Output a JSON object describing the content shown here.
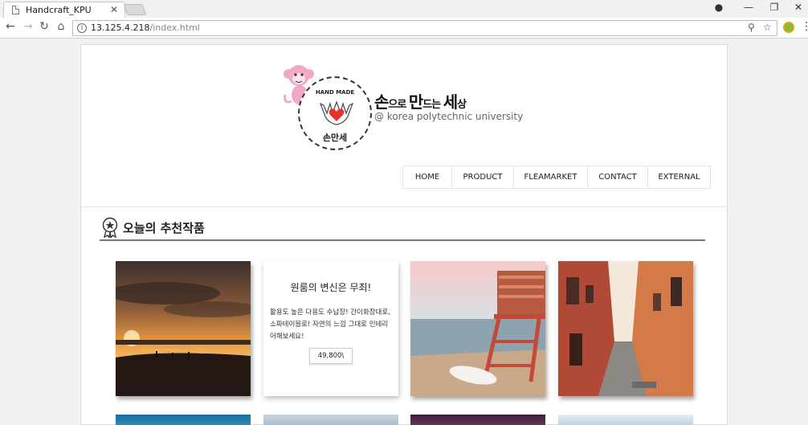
{
  "browser": {
    "tab_title": "Handcraft_KPU",
    "tab_close": "✕",
    "url_host": "13.125.4.218",
    "url_path": "/index.html",
    "info_glyph": "i",
    "back_glyph": "←",
    "forward_glyph": "→",
    "reload_glyph": "↻",
    "home_glyph": "⌂",
    "zoom_glyph": "⚲",
    "star_glyph": "☆",
    "menu_glyph": "⋮",
    "account_glyph": "●",
    "minimize_glyph": "—",
    "restore_glyph": "❐",
    "close_glyph": "✕"
  },
  "site": {
    "seal_top": "HAND MADE",
    "seal_bottom": "손만세",
    "title_big": "손",
    "title_small1": "으로 ",
    "title_big2": "만",
    "title_small2": "드는 ",
    "title_big3": "세",
    "title_small3": "상",
    "subtitle": "@ korea polytechnic university",
    "nav": [
      {
        "label": "HOME"
      },
      {
        "label": "PRODUCT"
      },
      {
        "label": "FLEAMARKET"
      },
      {
        "label": "CONTACT"
      },
      {
        "label": "EXTERNAL"
      }
    ]
  },
  "recommend": {
    "title": "오늘의 추천작품",
    "featured": {
      "title": "원룸의 변신은 무죄!",
      "desc": "활용도 높은 다용도 수납장! 간이화장대로, 소파테이블로! 자연의 느낌 그대로 인테리어해보세요!",
      "price": "49,800\\"
    }
  },
  "colors": {
    "accent_heart": "#e8302a",
    "monkey_pink": "#f2a6c8"
  }
}
